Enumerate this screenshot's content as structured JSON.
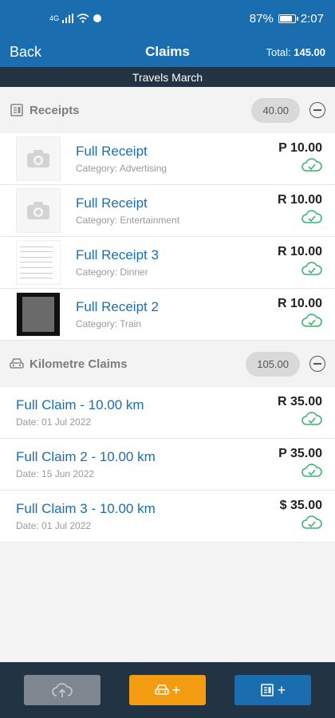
{
  "status": {
    "network": "4G",
    "battery": "87%",
    "battery_level": 0.87,
    "time": "2:07"
  },
  "nav": {
    "back_label": "Back",
    "title": "Claims",
    "total_label": "Total:",
    "total_value": "145.00"
  },
  "subheader": "Travels March",
  "receipts": {
    "label": "Receipts",
    "subtotal": "40.00",
    "items": [
      {
        "title": "Full Receipt",
        "category": "Category: Advertising",
        "amount": "P 10.00"
      },
      {
        "title": "Full Receipt",
        "category": "Category: Entertainment",
        "amount": "R 10.00"
      },
      {
        "title": "Full Receipt 3",
        "category": "Category: Dinner",
        "amount": "R 10.00"
      },
      {
        "title": "Full Receipt 2",
        "category": "Category: Train",
        "amount": "R 10.00"
      }
    ]
  },
  "kilometre": {
    "label": "Kilometre Claims",
    "subtotal": "105.00",
    "items": [
      {
        "title": "Full Claim - 10.00 km",
        "date": "Date: 01 Jul 2022",
        "amount": "R 35.00"
      },
      {
        "title": "Full Claim 2 - 10.00 km",
        "date": "Date: 15 Jun 2022",
        "amount": "P 35.00"
      },
      {
        "title": "Full Claim 3 - 10.00 km",
        "date": "Date: 01 Jul 2022",
        "amount": "$ 35.00"
      }
    ]
  },
  "footer": {
    "plus_symbol": "+"
  },
  "colors": {
    "accent": "#1a6eb0",
    "dark": "#223344",
    "synced": "#3cb371",
    "car_button": "#f39c12"
  }
}
